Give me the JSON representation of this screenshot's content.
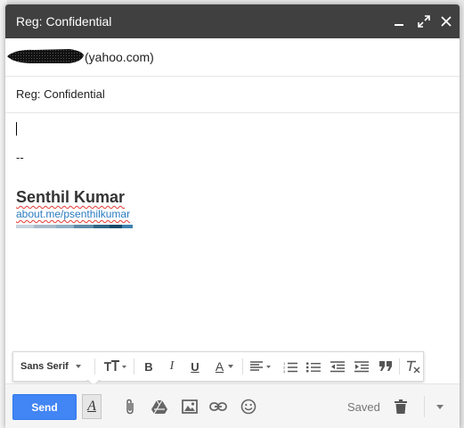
{
  "window": {
    "title": "Reg: Confidential",
    "controls": [
      "minimize",
      "pop-out",
      "close"
    ]
  },
  "recipients": {
    "visible_text": "(yahoo.com)"
  },
  "subject": "Reg: Confidential",
  "body": {
    "signature_separator": "--",
    "signature_name": "Senthil Kumar",
    "signature_link": "about.me/psenthilkumar"
  },
  "format_toolbar": {
    "font_family": "Sans Serif",
    "buttons": [
      "font-size",
      "bold",
      "italic",
      "underline",
      "text-color",
      "align",
      "numbered-list",
      "bulleted-list",
      "indent-less",
      "indent-more",
      "quote",
      "remove-formatting"
    ],
    "bold_label": "B",
    "italic_label": "I",
    "underline_label": "U",
    "text_color_label": "A"
  },
  "bottom_bar": {
    "send_label": "Send",
    "format_toggle_label": "A",
    "saved_label": "Saved"
  },
  "colors": {
    "titlebar": "#404040",
    "send_button": "#4285f4",
    "link": "#2a7bc0"
  }
}
